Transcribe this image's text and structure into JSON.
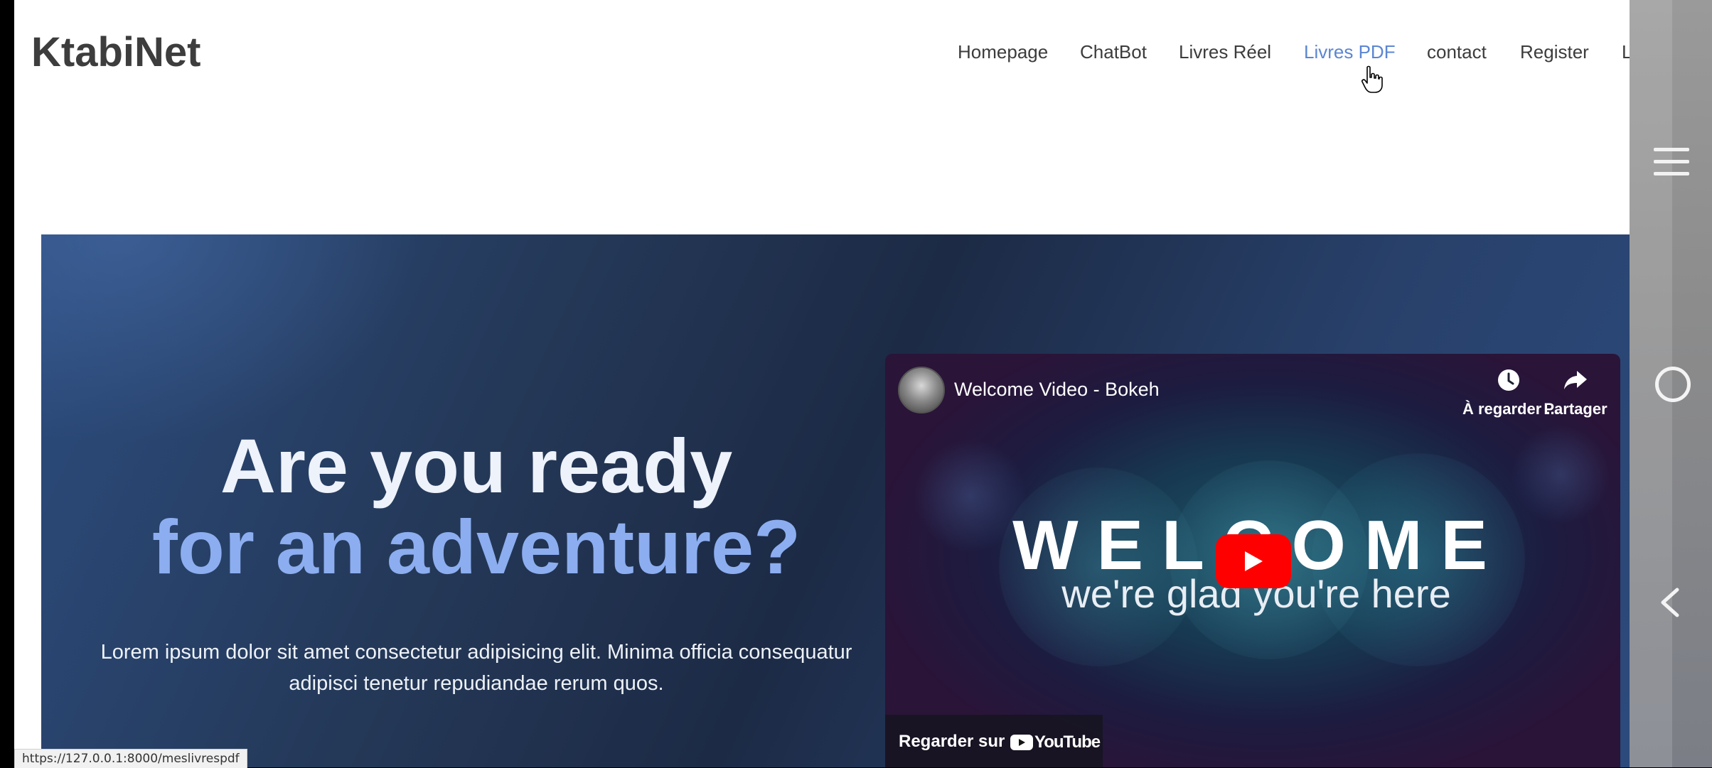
{
  "header": {
    "brand": "KtabiNet",
    "nav": [
      {
        "label": "Homepage",
        "active": false
      },
      {
        "label": "ChatBot",
        "active": false
      },
      {
        "label": "Livres Réel",
        "active": false
      },
      {
        "label": "Livres PDF",
        "active": true
      },
      {
        "label": "contact",
        "active": false
      },
      {
        "label": "Register",
        "active": false
      },
      {
        "label": "Login",
        "active": false
      }
    ]
  },
  "hero": {
    "headline_line1": "Are you ready",
    "headline_line2": "for an adventure?",
    "lead": "Lorem ipsum dolor sit amet consectetur adipisicing elit. Minima officia consequatur adipisci tenetur repudiandae rerum quos."
  },
  "video": {
    "title": "Welcome Video - Bokeh",
    "watch_later_label": "À regarder ...",
    "share_label": "Partager",
    "welcome_text": "WELCOME",
    "tagline": "we're glad you're here",
    "watch_on_label": "Regarder sur",
    "youtube_wordmark": "YouTube",
    "icons": {
      "watch_later": "clock-icon",
      "share": "share-arrow-icon",
      "play": "play-icon"
    }
  },
  "side_panel": {
    "icons": [
      "hamburger-menu-icon",
      "home-circle-icon",
      "back-chevron-icon"
    ]
  },
  "status_bar": {
    "url": "https://127.0.0.1:8000/meslivrespdf"
  },
  "colors": {
    "brand_text": "#3d3d3d",
    "nav_active": "#5b86d3",
    "headline_accent": "#8caef0",
    "youtube_red": "#ff0000"
  }
}
